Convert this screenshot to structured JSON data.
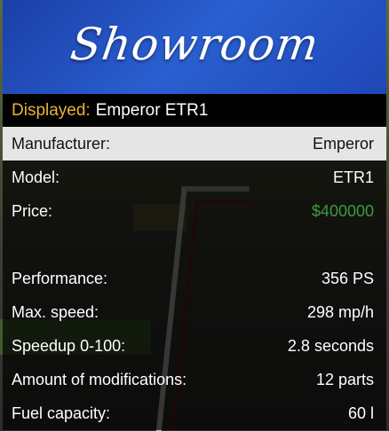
{
  "banner": {
    "title": "Showroom"
  },
  "subtitle": {
    "label": "Displayed:",
    "value": "Emperor ETR1"
  },
  "rows": [
    {
      "label": "Manufacturer:",
      "value": "Emperor"
    },
    {
      "label": "Model:",
      "value": "ETR1"
    },
    {
      "label": "Price:",
      "value": "$400000"
    },
    {
      "label": "Performance:",
      "value": "356 PS"
    },
    {
      "label": "Max. speed:",
      "value": "298 mp/h"
    },
    {
      "label": "Speedup 0-100:",
      "value": "2.8 seconds"
    },
    {
      "label": "Amount of modifications:",
      "value": "12 parts"
    },
    {
      "label": "Fuel capacity:",
      "value": "60 l"
    }
  ],
  "colors": {
    "banner": "#2a5fd0",
    "subtitle_label": "#e8b23a",
    "price": "#3f9a3f",
    "selected_row": "#e5e5e5"
  }
}
